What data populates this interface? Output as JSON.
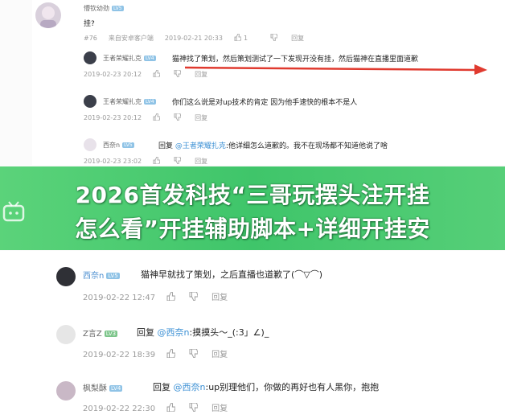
{
  "top_thread": {
    "header": {
      "username": "懵钦幼劲",
      "reply": "挂?",
      "floor": "#76",
      "source": "来自安卓客户端",
      "time": "2019-02-21 20:33",
      "likes": "1",
      "reply_label": "回复"
    },
    "replies": [
      {
        "username": "王者荣耀扎克",
        "text": "猫神找了策划，然后策划测试了一下发现开没有挂，然后猫神在直播里面道歉",
        "time": "2019-02-23 20:12",
        "reply_label": "回复"
      },
      {
        "username": "王者荣耀扎克",
        "text": "你们这么说是对up技术的肯定 因为他手速快的根本不是人",
        "time": "2019-02-23 20:12",
        "reply_label": "回复"
      },
      {
        "username": "西奈n",
        "prefix": "回复",
        "mention": "@王者荣耀扎克",
        "text": ":他详细怎么道歉的。我不在现场都不知道他说了啥",
        "time": "2019-02-23 23:02",
        "reply_label": "回复"
      }
    ]
  },
  "banner": {
    "line1": "2026首发科技“三哥玩摆头注开挂",
    "line2": "怎么看”开挂辅助脚本+详细开挂安"
  },
  "bottom_thread": {
    "replies": [
      {
        "username": "西奈n",
        "text": "猫神早就找了策划，之后直播也道歉了(⌒▽⌒)",
        "time": "2019-02-22 12:47",
        "reply_label": "回复"
      },
      {
        "username": "Z言Z",
        "prefix": "回复",
        "mention": "@西奈n",
        "text": ":摸摸头～_(:3」∠)_",
        "time": "2019-02-22 18:39",
        "reply_label": "回复"
      },
      {
        "username": "枫梨酥",
        "prefix": "回复",
        "mention": "@西奈n",
        "text": ":up别理他们，你做的再好也有人黑你，抱抱",
        "time": "2019-02-22 22:30",
        "reply_label": "回复"
      }
    ]
  },
  "colors": {
    "banner": "#47c96f",
    "arrow": "#e03a2f",
    "mention": "#3a8fd4"
  }
}
